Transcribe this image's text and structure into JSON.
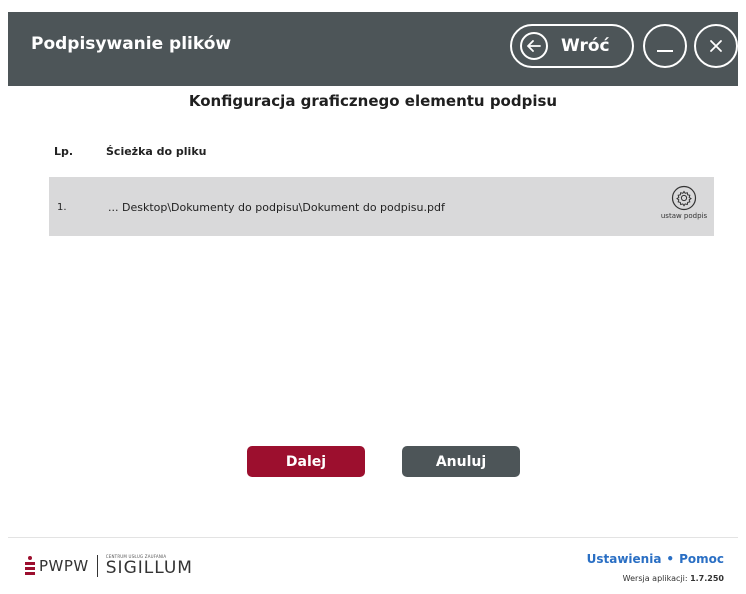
{
  "window": {
    "title": "Podpisywanie plików",
    "back_label": "Wróć"
  },
  "main": {
    "section_title": "Konfiguracja graficznego elementu podpisu",
    "table": {
      "headers": [
        "Lp.",
        "Ścieżka do pliku"
      ],
      "rows": [
        {
          "no": "1.",
          "path": "... Desktop\\Dokumenty do podpisu\\Dokument do podpisu.pdf",
          "action_label": "ustaw podpis"
        }
      ]
    }
  },
  "buttons": {
    "next_label": "Dalej",
    "cancel_label": "Anuluj"
  },
  "footer": {
    "logo_text": "PWPW",
    "logo_small": "CENTRUM USŁUG ZAUFANIA",
    "logo_product": "SIGILLUM",
    "settings_label": "Ustawienia",
    "separator": "•",
    "help_label": "Pomoc",
    "version_prefix": "Wersja aplikacji:",
    "version_value": "1.7.250"
  },
  "colors": {
    "titlebar": "#4d5558",
    "primary": "#9c0f2e",
    "secondary": "#4d5558",
    "row_bg": "#d9d9da",
    "link": "#2a6fc4"
  },
  "icons": [
    "arrow-left-icon",
    "minimize-icon",
    "close-icon",
    "gear-icon"
  ]
}
